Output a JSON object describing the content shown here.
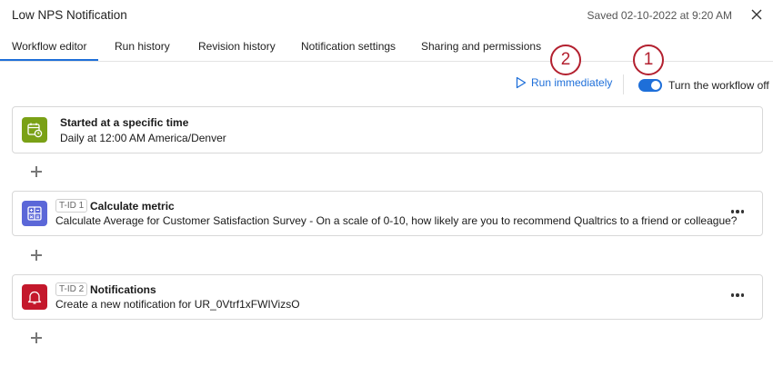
{
  "header": {
    "title": "Low NPS Notification",
    "saved": "Saved 02-10-2022 at 9:20 AM",
    "close_icon": "close-icon"
  },
  "tabs": [
    {
      "label": "Workflow editor",
      "active": true
    },
    {
      "label": "Run history",
      "active": false
    },
    {
      "label": "Revision history",
      "active": false
    },
    {
      "label": "Notification settings",
      "active": false
    },
    {
      "label": "Sharing and permissions",
      "active": false
    }
  ],
  "actions": {
    "run_label": "Run immediately",
    "run_icon": "play-outline-icon",
    "toggle_on": true,
    "toggle_label": "Turn the workflow off"
  },
  "callouts": [
    "1",
    "2"
  ],
  "trigger": {
    "icon": "calendar-clock-icon",
    "title": "Started at a specific time",
    "subtitle": "Daily at 12:00 AM America/Denver"
  },
  "tasks": [
    {
      "tid": "T-ID 1",
      "icon": "calculator-icon",
      "title": "Calculate metric",
      "description": "Calculate Average for Customer Satisfaction Survey - On a scale of 0-10, how likely are you to recommend Qualtrics to a friend or colleague?"
    },
    {
      "tid": "T-ID 2",
      "icon": "bell-icon",
      "title": "Notifications",
      "description": "Create a new notification for UR_0Vtrf1xFWIVizsO"
    }
  ],
  "colors": {
    "accent": "#1e6fd9",
    "trigger_icon_bg": "#7aa116",
    "calc_icon_bg": "#5b67d8",
    "notify_icon_bg": "#c4182c",
    "callout": "#b3202f"
  }
}
